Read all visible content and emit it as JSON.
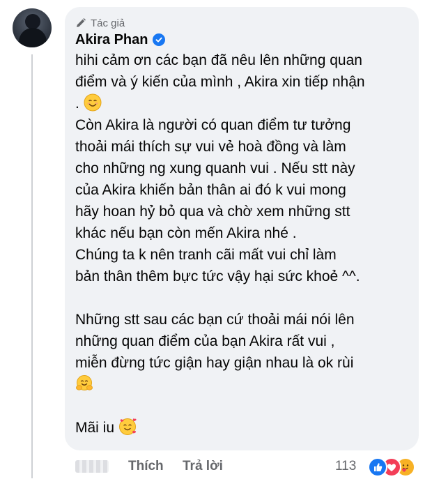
{
  "comment": {
    "author_tag": "Tác giả",
    "author_name": "Akira Phan",
    "verified": true,
    "lines": [
      {
        "text": "hihi cảm ơn các bạn đã nêu lên những quan",
        "emoji": ""
      },
      {
        "text": "điểm và ý kiến của mình , Akira xin tiếp nhận",
        "emoji": ""
      },
      {
        "text": ". ",
        "emoji": "smiling-face-emoji"
      },
      {
        "text": "Còn Akira là người có quan điểm tư tưởng",
        "emoji": ""
      },
      {
        "text": "thoải mái thích sự vui vẻ hoà đồng và làm",
        "emoji": ""
      },
      {
        "text": "cho những ng xung quanh vui . Nếu stt này",
        "emoji": ""
      },
      {
        "text": "của Akira khiến bản thân ai đó k vui mong",
        "emoji": ""
      },
      {
        "text": "hãy hoan hỷ bỏ qua và chờ xem những stt",
        "emoji": ""
      },
      {
        "text": "khác nếu bạn còn mến Akira nhé .",
        "emoji": ""
      },
      {
        "text": "Chúng ta k nên tranh cãi mất vui chỉ làm",
        "emoji": ""
      },
      {
        "text": "bản thân thêm bực tức vậy hại sức khoẻ ^^.",
        "emoji": ""
      },
      {
        "text": "",
        "emoji": ""
      },
      {
        "text": "Những stt sau các bạn cứ thoải mái nói lên",
        "emoji": ""
      },
      {
        "text": "những quan điểm của bạn Akira rất vui ,",
        "emoji": ""
      },
      {
        "text": "miễn đừng tức giận hay giận nhau là ok rùi",
        "emoji": ""
      },
      {
        "text": "",
        "emoji": "hugging-face-emoji"
      },
      {
        "text": "",
        "emoji": ""
      },
      {
        "text": "Mãi iu ",
        "emoji": "smiling-face-with-hearts-emoji"
      }
    ]
  },
  "footer": {
    "like_label": "Thích",
    "reply_label": "Trả lời",
    "reaction_count": "113",
    "reactions": [
      "like-reaction-icon",
      "love-reaction-icon",
      "care-reaction-icon"
    ]
  },
  "colors": {
    "bubble": "#f0f2f5",
    "secondary_text": "#65676b",
    "verified_blue": "#1877f2",
    "like_blue": "#1877f2",
    "love_red": "#f33e58",
    "care_yellow": "#f7b125"
  }
}
